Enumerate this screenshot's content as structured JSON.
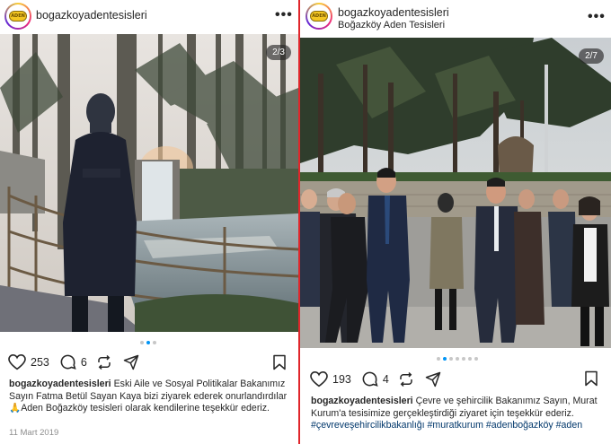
{
  "left_post": {
    "username": "bogazkoyadentesisleri",
    "avatar_text": "ADEN",
    "slide_counter": "2/3",
    "likes": "253",
    "comments": "6",
    "caption_user": "bogazkoyadentesisleri",
    "caption_text": "Eski Aile ve Sosyal Politikalar Bakanımız Sayın Fatma Betül Sayan Kaya bizi ziyarek ederek onurlandırdılar🙏Aden Boğazköy tesisleri olarak kendilerine teşekkür ederiz.",
    "date": "11 Mart 2019",
    "dots_total": 3,
    "dots_active_index": 1
  },
  "right_post": {
    "username": "bogazkoyadentesisleri",
    "location": "Boğazköy Aden Tesisleri",
    "avatar_text": "ADEN",
    "slide_counter": "2/7",
    "likes": "193",
    "comments": "4",
    "caption_user": "bogazkoyadentesisleri",
    "caption_text": "Çevre ve şehircilik Bakanımız Sayın, Murat Kurum'a tesisimize gerçekleştirdiği ziyaret için teşekkür ederiz.",
    "hashtags": "#çevreveşehircilikbakanlığı #muratkurum #adenboğazköy #aden",
    "dots_total": 7,
    "dots_active_index": 1
  },
  "icons": [
    "heart-icon",
    "comment-icon",
    "share-icon",
    "send-icon",
    "bookmark-icon",
    "more-icon"
  ],
  "colors": {
    "divider": "#e0262b",
    "dot_active": "#0095f6",
    "hashtag": "#00376b",
    "date": "#8e8e8e"
  }
}
